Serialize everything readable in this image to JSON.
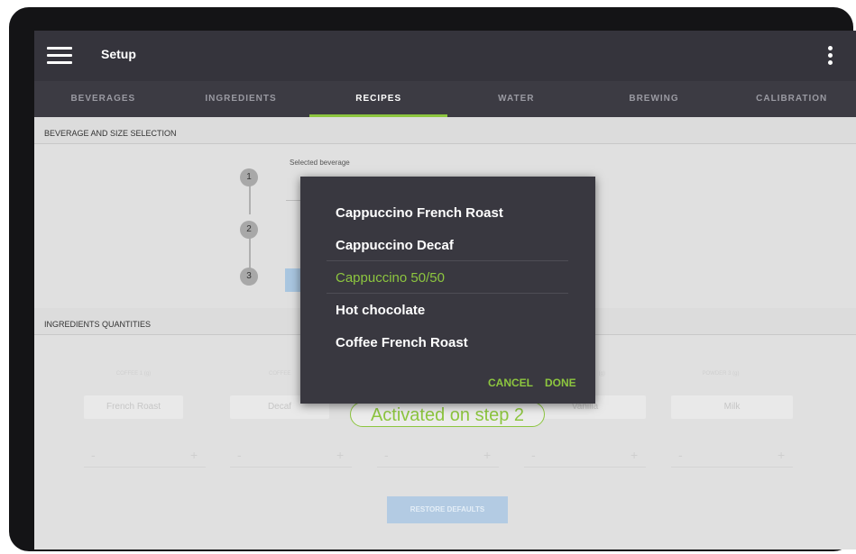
{
  "app": {
    "title": "Setup"
  },
  "tabs": [
    {
      "label": "BEVERAGES",
      "active": false
    },
    {
      "label": "INGREDIENTS",
      "active": false
    },
    {
      "label": "RECIPES",
      "active": true
    },
    {
      "label": "WATER",
      "active": false
    },
    {
      "label": "BREWING",
      "active": false
    },
    {
      "label": "CALIBRATION",
      "active": false
    }
  ],
  "beverage_section": {
    "title": "BEVERAGE AND SIZE SELECTION",
    "steps": [
      "1",
      "2",
      "3"
    ],
    "selected_beverage_label": "Selected beverage"
  },
  "ingredients_section": {
    "title": "INGREDIENTS QUANTITIES",
    "columns": [
      {
        "label": "COFFEE 1 (g)",
        "value": "French Roast"
      },
      {
        "label": "COFFEE",
        "value": "Decaf"
      },
      {
        "label": "",
        "value": ""
      },
      {
        "label": "(g)",
        "value": "Vanilla"
      },
      {
        "label": "POWDER 3 (g)",
        "value": "Milk"
      }
    ],
    "minus": "-",
    "plus": "+",
    "restore_label": "RESTORE DEFAULTS"
  },
  "badge": {
    "text": "Activated on step 2"
  },
  "dialog": {
    "items": [
      "Cappuccino French Roast",
      "Cappuccino Decaf",
      "Cappuccino 50/50",
      "Hot chocolate",
      "Coffee French Roast"
    ],
    "selected_index": 2,
    "cancel_label": "CANCEL",
    "done_label": "DONE"
  },
  "colors": {
    "accent": "#8dc63f",
    "appbar": "#35343c",
    "dialog": "#393840"
  }
}
